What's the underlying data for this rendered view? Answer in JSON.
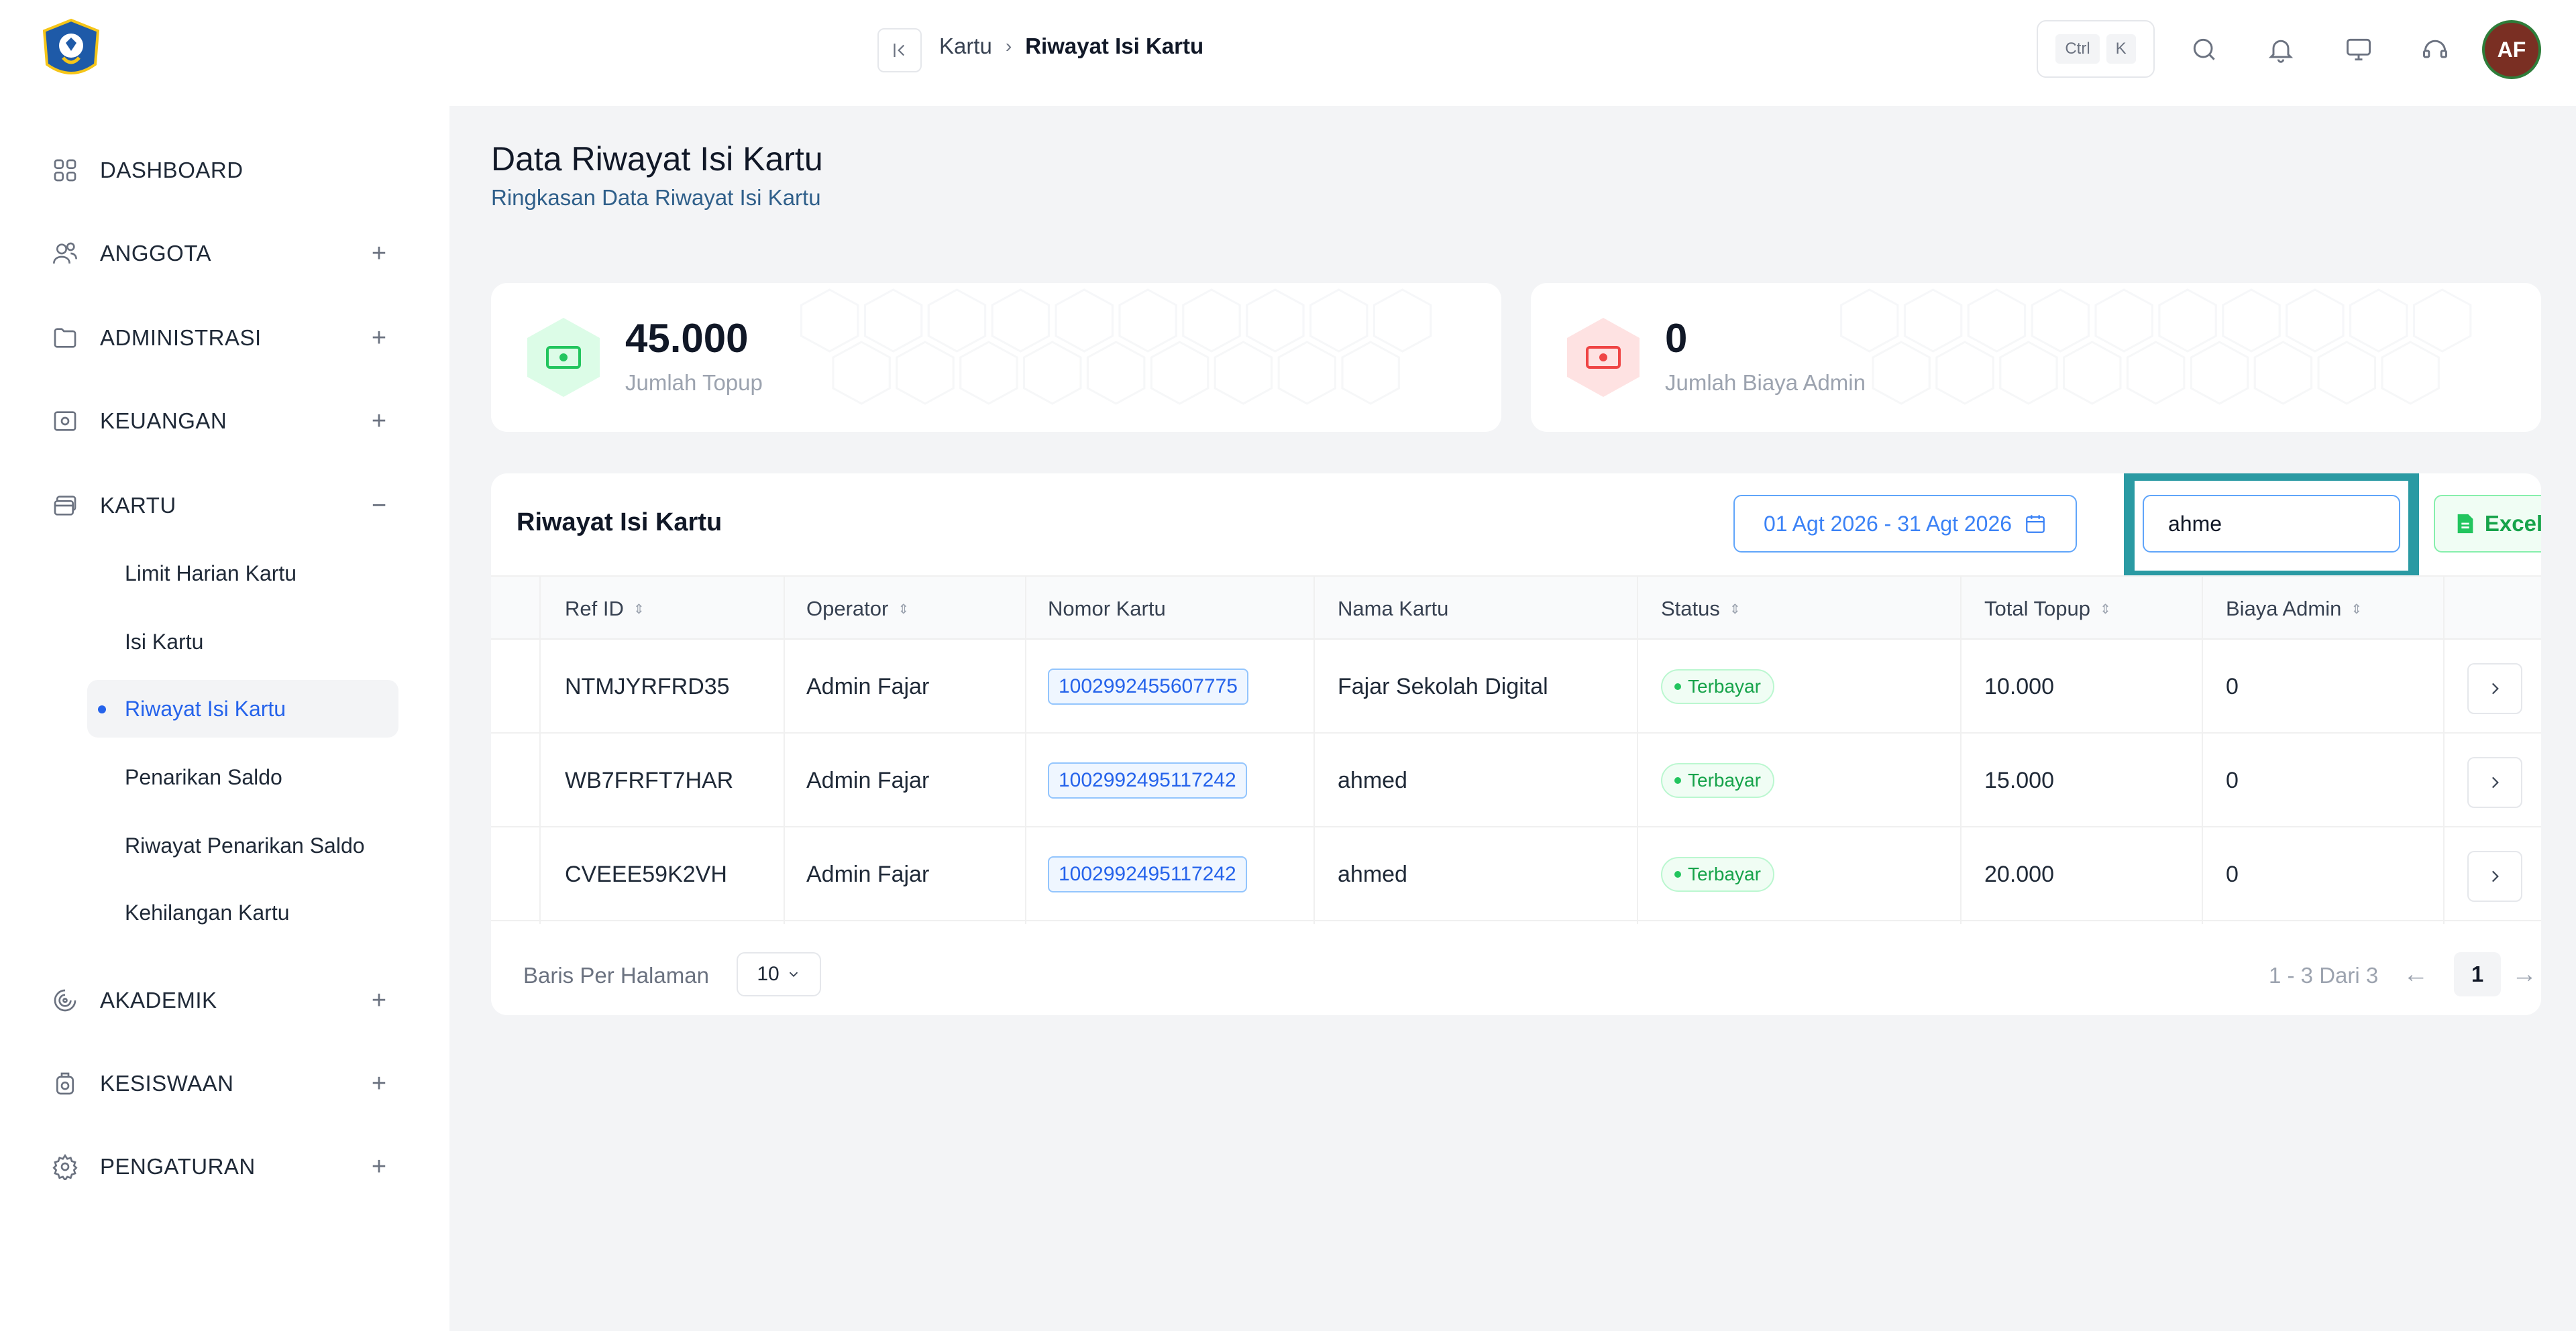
{
  "sidebar": {
    "items": [
      {
        "label": "DASHBOARD",
        "icon": "dashboard-grid-icon",
        "toggle": ""
      },
      {
        "label": "ANGGOTA",
        "icon": "users-icon",
        "toggle": "+"
      },
      {
        "label": "ADMINISTRASI",
        "icon": "folder-icon",
        "toggle": "+"
      },
      {
        "label": "KEUANGAN",
        "icon": "money-icon",
        "toggle": "+"
      },
      {
        "label": "KARTU",
        "icon": "card-icon",
        "toggle": "−"
      },
      {
        "label": "AKADEMIK",
        "icon": "academic-icon",
        "toggle": "+"
      },
      {
        "label": "KESISWAAN",
        "icon": "student-icon",
        "toggle": "+"
      },
      {
        "label": "PENGATURAN",
        "icon": "gear-icon",
        "toggle": "+"
      }
    ],
    "kartu_sub": [
      {
        "label": "Limit Harian Kartu"
      },
      {
        "label": "Isi Kartu"
      },
      {
        "label": "Riwayat Isi Kartu"
      },
      {
        "label": "Penarikan Saldo"
      },
      {
        "label": "Riwayat Penarikan Saldo"
      },
      {
        "label": "Kehilangan Kartu"
      }
    ]
  },
  "header": {
    "breadcrumb_root": "Kartu",
    "breadcrumb_sep": "›",
    "breadcrumb_current": "Riwayat Isi Kartu",
    "kbd_ctrl": "Ctrl",
    "kbd_k": "K",
    "avatar_initials": "AF"
  },
  "page": {
    "title": "Data Riwayat Isi Kartu",
    "subtitle": "Ringkasan Data Riwayat Isi Kartu"
  },
  "stats": [
    {
      "value": "45.000",
      "label": "Jumlah Topup",
      "color": "#22c55e"
    },
    {
      "value": "0",
      "label": "Jumlah Biaya Admin",
      "color": "#ef4444"
    }
  ],
  "table": {
    "title": "Riwayat Isi Kartu",
    "date_range": "01 Agt 2026 - 31 Agt 2026",
    "search_value": "ahme",
    "excel_label": "Excel",
    "columns": [
      "Ref ID",
      "Operator",
      "Nomor Kartu",
      "Nama Kartu",
      "Status",
      "Total Topup",
      "Biaya Admin"
    ],
    "rows": [
      {
        "ref_id": "NTMJYRFRD35",
        "operator": "Admin Fajar",
        "nomor_kartu": "1002992455607775",
        "nama_kartu": "Fajar Sekolah Digital",
        "status": "Terbayar",
        "total_topup": "10.000",
        "biaya_admin": "0"
      },
      {
        "ref_id": "WB7FRFT7HAR",
        "operator": "Admin Fajar",
        "nomor_kartu": "1002992495117242",
        "nama_kartu": "ahmed",
        "status": "Terbayar",
        "total_topup": "15.000",
        "biaya_admin": "0"
      },
      {
        "ref_id": "CVEEE59K2VH",
        "operator": "Admin Fajar",
        "nomor_kartu": "1002992495117242",
        "nama_kartu": "ahmed",
        "status": "Terbayar",
        "total_topup": "20.000",
        "biaya_admin": "0"
      }
    ],
    "footer": {
      "rows_per_page_label": "Baris Per Halaman",
      "rows_per_page_value": "10",
      "range_text": "1 - 3 Dari 3",
      "current_page": "1",
      "prev": "←",
      "next": "→"
    }
  },
  "colors": {
    "accent": "#2563eb",
    "highlight": "#2a9aa3",
    "success": "#16a34a"
  }
}
